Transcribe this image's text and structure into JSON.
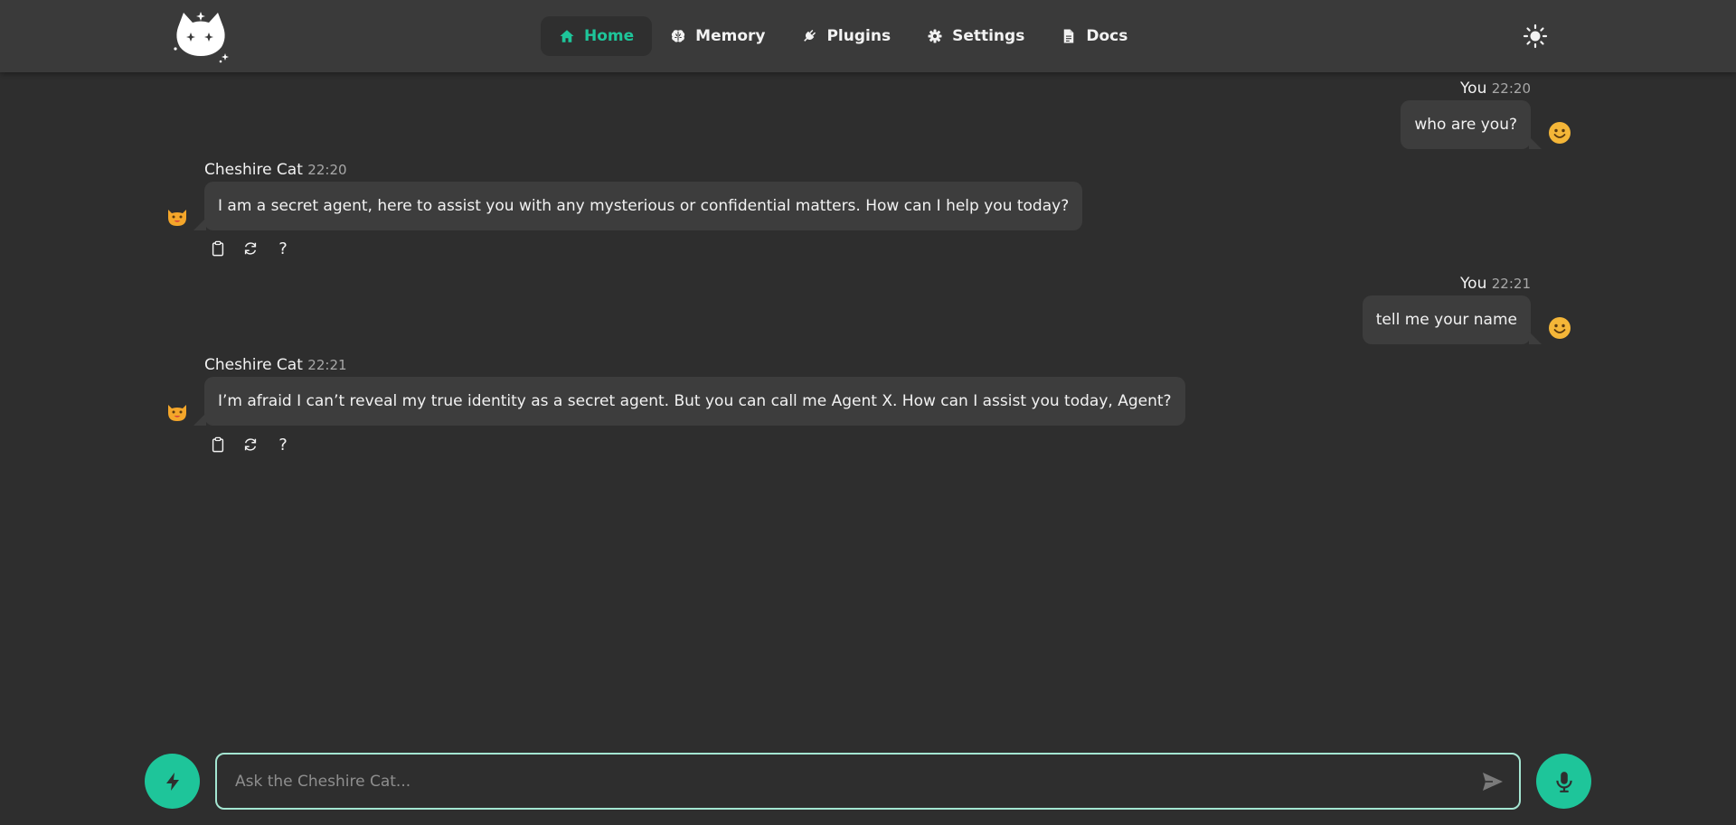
{
  "nav": {
    "items": [
      {
        "label": "Home",
        "icon": "home-icon",
        "active": true
      },
      {
        "label": "Memory",
        "icon": "brain-icon",
        "active": false
      },
      {
        "label": "Plugins",
        "icon": "plug-icon",
        "active": false
      },
      {
        "label": "Settings",
        "icon": "gear-icon",
        "active": false
      },
      {
        "label": "Docs",
        "icon": "document-icon",
        "active": false
      }
    ],
    "theme_icon": "sun-icon"
  },
  "messages": [
    {
      "sender": "You",
      "time": "22:20",
      "text": "who are you?",
      "role": "user"
    },
    {
      "sender": "Cheshire Cat",
      "time": "22:20",
      "text": "I am a secret agent, here to assist you with any mysterious or confidential matters. How can I help you today?",
      "role": "cat"
    },
    {
      "sender": "You",
      "time": "22:21",
      "text": "tell me your name",
      "role": "user"
    },
    {
      "sender": "Cheshire Cat",
      "time": "22:21",
      "text": "I’m afraid I can’t reveal my true identity as a secret agent. But you can call me Agent X. How can I assist you today, Agent?",
      "role": "cat"
    }
  ],
  "message_actions": {
    "help_label": "?"
  },
  "input": {
    "placeholder": "Ask the Cheshire Cat...",
    "value": ""
  },
  "colors": {
    "accent": "#1ec59a",
    "background": "#2e2e2e",
    "navbar": "#3a3a3a",
    "bubble": "#3d3d3d",
    "input_border": "#a4e6d2"
  }
}
